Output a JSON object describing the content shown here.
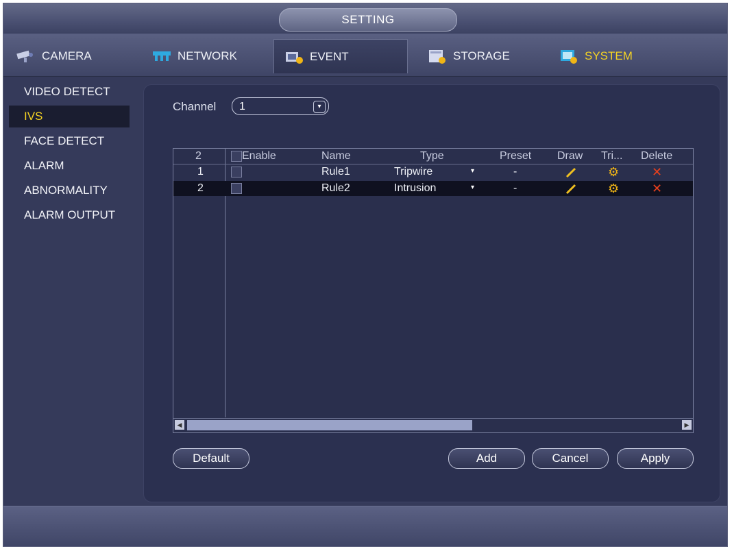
{
  "window": {
    "title": "SETTING"
  },
  "tabs": [
    {
      "label": "CAMERA",
      "icon": "camera-icon"
    },
    {
      "label": "NETWORK",
      "icon": "network-icon"
    },
    {
      "label": "EVENT",
      "icon": "event-icon",
      "active": true
    },
    {
      "label": "STORAGE",
      "icon": "storage-icon"
    },
    {
      "label": "SYSTEM",
      "icon": "system-icon",
      "highlight_color": "#f5d323"
    }
  ],
  "sidebar": {
    "items": [
      {
        "label": "VIDEO DETECT"
      },
      {
        "label": "IVS",
        "active": true
      },
      {
        "label": "FACE DETECT"
      },
      {
        "label": "ALARM"
      },
      {
        "label": "ABNORMALITY"
      },
      {
        "label": "ALARM OUTPUT"
      }
    ]
  },
  "channel": {
    "label": "Channel",
    "value": "1"
  },
  "table": {
    "headers": {
      "index": "2",
      "enable": "Enable",
      "name": "Name",
      "type": "Type",
      "preset": "Preset",
      "draw": "Draw",
      "trigger": "Tri...",
      "delete": "Delete"
    },
    "rows": [
      {
        "index": "1",
        "name": "Rule1",
        "type": "Tripwire",
        "preset": "-"
      },
      {
        "index": "2",
        "name": "Rule2",
        "type": "Intrusion",
        "preset": "-"
      }
    ]
  },
  "buttons": {
    "default": "Default",
    "add": "Add",
    "cancel": "Cancel",
    "apply": "Apply"
  },
  "colors": {
    "accent": "#f5d323",
    "gear": "#f0b516",
    "delete": "#e8401d",
    "pencil": "#f0c020"
  }
}
